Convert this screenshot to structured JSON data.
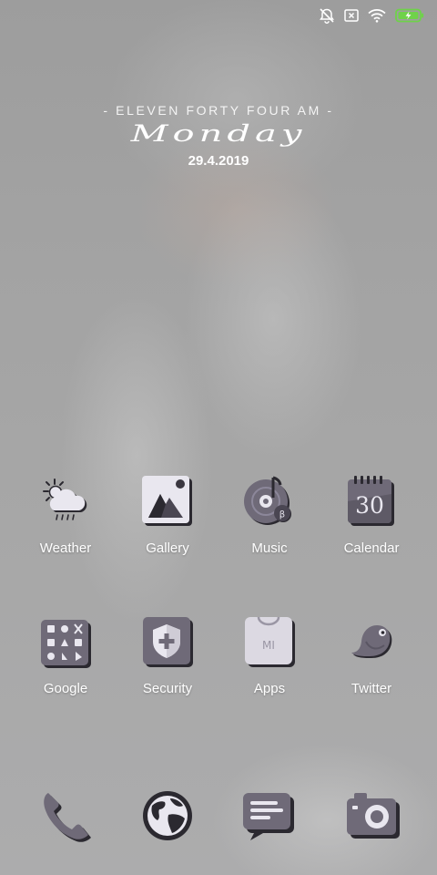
{
  "status_bar": {
    "icons": [
      "alarm-off-icon",
      "no-sim-icon",
      "wifi-icon",
      "battery-charging-icon"
    ]
  },
  "clock": {
    "time_words": "- ELEVEN FORTY FOUR AM -",
    "day": "Monday",
    "date": "29.4.2019"
  },
  "apps": {
    "row1": [
      {
        "label": "Weather",
        "icon": "weather-cloud-rain-icon"
      },
      {
        "label": "Gallery",
        "icon": "gallery-mountain-icon"
      },
      {
        "label": "Music",
        "icon": "music-disc-icon"
      },
      {
        "label": "Calendar",
        "icon": "calendar-icon",
        "day_number": "30"
      }
    ],
    "row2": [
      {
        "label": "Google",
        "icon": "google-folder-icon"
      },
      {
        "label": "Security",
        "icon": "security-shield-icon"
      },
      {
        "label": "Apps",
        "icon": "mi-apps-bag-icon",
        "badge": "MI"
      },
      {
        "label": "Twitter",
        "icon": "twitter-bird-icon"
      }
    ]
  },
  "music_badge": "β",
  "dock": [
    {
      "icon": "phone-icon"
    },
    {
      "icon": "browser-globe-icon"
    },
    {
      "icon": "messages-icon"
    },
    {
      "icon": "camera-icon"
    }
  ],
  "colors": {
    "icon_face": "#6f6a78",
    "icon_dark": "#2b2930",
    "icon_light": "#e9e7ef",
    "battery_green": "#6fd24a"
  }
}
